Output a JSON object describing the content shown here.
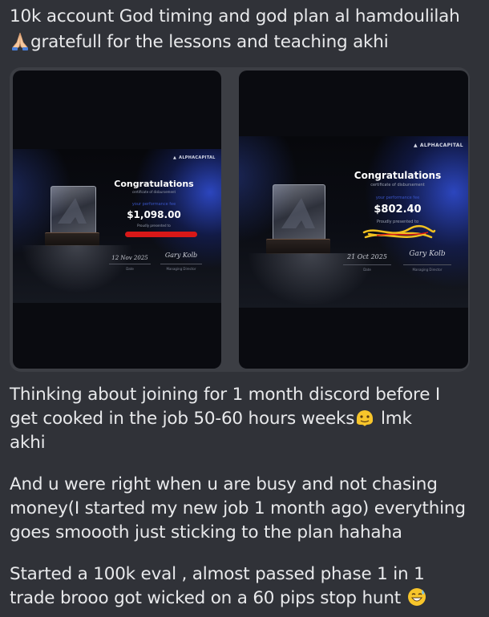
{
  "message": {
    "line1": "10k account God timing and god plan al hamdoulilah",
    "line2_text": "grateful​l for the lessons and teaching akhi",
    "para2_line1": "Thinking about joining for 1 month discord before I",
    "para2_line2a": "get cooked in the job 50-60 hours weeks",
    "para2_line2b": " lmk",
    "para2_line3": "akhi",
    "para3_line1": "And u were right when u are busy and not chasing",
    "para3_line2": "money(I started my new job 1 month ago) everything",
    "para3_line3": "goes smoooth just sticking to the plan hahaha",
    "para4_line1": "Started a 100k eval , almost passed phase 1 in 1",
    "para4_line2": "trade brooo got wicked on a 60 pips stop hunt",
    "emojis": [
      "folded-hands-emoji",
      "melting-face-emoji",
      "grinning-sweat-emoji"
    ]
  },
  "attachments": [
    {
      "brand": "ALPHACAPITAL",
      "title": "Congratulations",
      "subtitle": "certificate of disbursement",
      "perf_label": "your performance fee",
      "amount": "$1,098.00",
      "presented": "Proudly presented to",
      "date": "12 Nov 2025",
      "date_label": "Date",
      "sign_label": "Managing Director",
      "signature": "Gary Kolb"
    },
    {
      "brand": "ALPHACAPITAL",
      "title": "Congratulations",
      "subtitle": "certificate of disbursement",
      "perf_label": "your performance fee",
      "amount": "$802.40",
      "presented": "Proudly presented to",
      "date": "21 Oct 2025",
      "date_label": "Date",
      "sign_label": "Managing Director",
      "signature": "Gary Kolb"
    }
  ],
  "colors": {
    "background": "#303238",
    "text": "#e8e9eb",
    "accent_blue": "#3a55c8",
    "redaction_red": "#d81818",
    "redaction_yellow": "#f0c020"
  }
}
